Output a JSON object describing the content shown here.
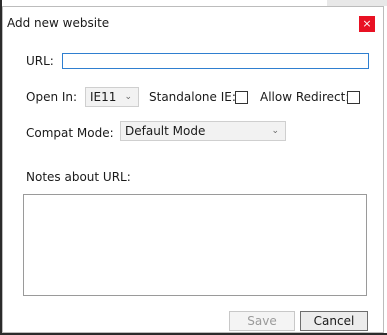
{
  "dialog": {
    "title": "Add new website",
    "close_label": "×"
  },
  "url": {
    "label": "URL:",
    "value": "",
    "placeholder": ""
  },
  "open_in": {
    "label": "Open In:",
    "selected": "IE11"
  },
  "standalone_ie": {
    "label": "Standalone IE:",
    "checked": false
  },
  "allow_redirect": {
    "label": "Allow Redirect:",
    "checked": false
  },
  "compat_mode": {
    "label": "Compat Mode:",
    "selected": "Default Mode"
  },
  "notes": {
    "label": "Notes about URL:",
    "value": ""
  },
  "buttons": {
    "save": "Save",
    "cancel": "Cancel"
  },
  "icons": {
    "dropdown": "chevron-down-icon",
    "close": "close-icon"
  },
  "colors": {
    "close_bg": "#e81123",
    "input_focus_border": "#2f7fd0"
  }
}
